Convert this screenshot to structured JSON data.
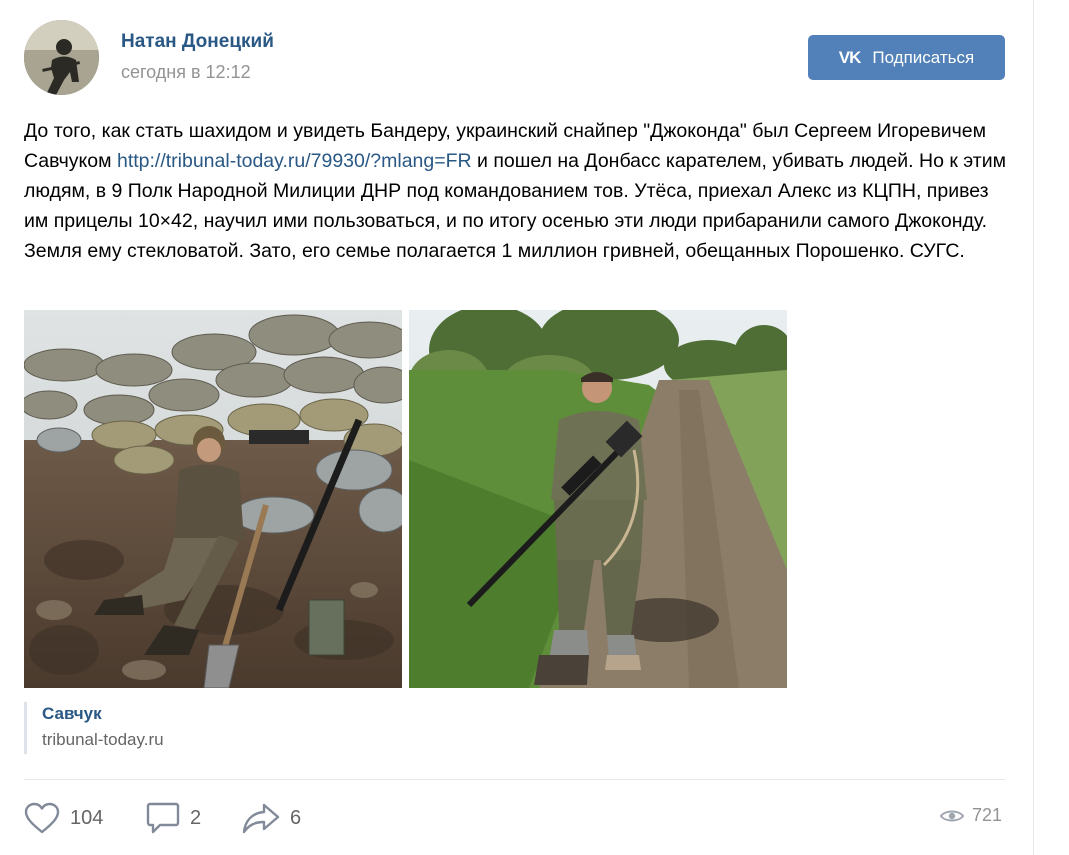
{
  "post": {
    "author": "Натан Донецкий",
    "time": "сегодня в 12:12",
    "subscribe_label": "Подписаться",
    "text_part1": "До того, как стать шахидом и увидеть Бандеру, украинский снайпер \"Джоконда\" был Сергеем Игоревичем Савчуком ",
    "link_url": "http://tribunal-today.ru/79930/?mlang=FR",
    "text_part2": " и пошел на Донбасс карателем, убивать людей. Но к этим людям, в 9 Полк Народной Милиции ДНР под командованием тов. Утёса, приехал Алекс из КЦПН, привез им прицелы 10×42, научил ими пользоваться, и по итогу осенью эти люди прибаранили самого Джоконду. Земля ему стекловатой. Зато, его семье полагается 1 миллион гривней, обещанных Порошенко. СУГС."
  },
  "link_attachment": {
    "title": "Савчук",
    "domain": "tribunal-today.ru"
  },
  "actions": {
    "likes": "104",
    "comments": "2",
    "shares": "6",
    "views": "721"
  },
  "icons": {
    "vk_logo": "vk-icon",
    "like": "heart-icon",
    "comment": "comment-icon",
    "share": "share-arrow-icon",
    "views": "eye-icon"
  },
  "colors": {
    "link": "#2a5885",
    "button": "#5181b8",
    "muted": "#939393",
    "divider": "#e7e8ec"
  }
}
